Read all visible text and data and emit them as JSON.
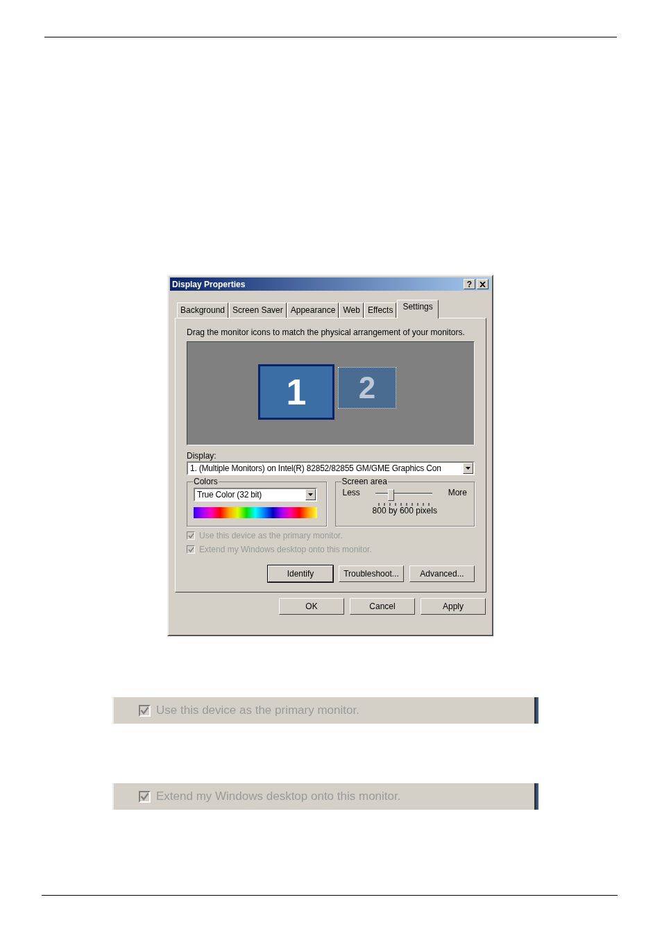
{
  "dialog": {
    "title": "Display Properties",
    "help_button": "?",
    "tabs": [
      {
        "label": "Background",
        "selected": false
      },
      {
        "label": "Screen Saver",
        "selected": false
      },
      {
        "label": "Appearance",
        "selected": false
      },
      {
        "label": "Web",
        "selected": false
      },
      {
        "label": "Effects",
        "selected": false
      },
      {
        "label": "Settings",
        "selected": true
      }
    ],
    "instruction": "Drag the monitor icons to match the physical arrangement of your monitors.",
    "monitors": [
      {
        "label": "1",
        "selected": true,
        "attached": true
      },
      {
        "label": "2",
        "selected": false,
        "attached": false
      }
    ],
    "display_label": "Display:",
    "display_value": "1. (Multiple Monitors) on Intel(R) 82852/82855 GM/GME Graphics Con",
    "colors": {
      "legend": "Colors",
      "value": "True Color (32 bit)"
    },
    "screen_area": {
      "legend": "Screen area",
      "min_label": "Less",
      "max_label": "More",
      "level": 0.25,
      "reading": "800 by 600 pixels"
    },
    "checkboxes": [
      {
        "label": "Use this device as the primary monitor.",
        "checked": true,
        "disabled": true
      },
      {
        "label": "Extend my Windows desktop onto this monitor.",
        "checked": true,
        "disabled": true
      }
    ],
    "tab_buttons": [
      "Identify",
      "Troubleshoot...",
      "Advanced..."
    ],
    "footer_buttons": [
      "OK",
      "Cancel",
      "Apply"
    ]
  },
  "zoomed_strips": [
    {
      "label": "Use this device as the primary monitor.",
      "checked": true,
      "disabled": true
    },
    {
      "label": "Extend my Windows desktop onto this monitor.",
      "checked": true,
      "disabled": true
    }
  ]
}
